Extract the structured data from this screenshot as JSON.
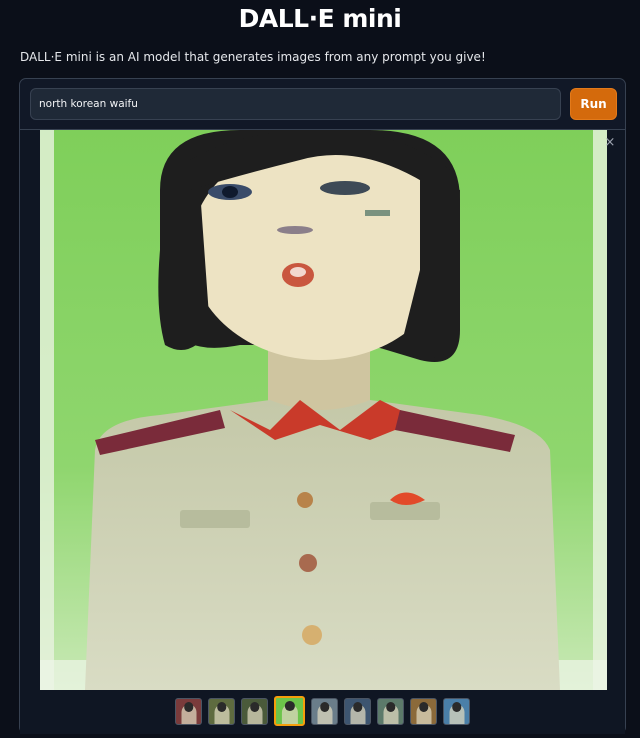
{
  "app": {
    "title": "DALL·E mini",
    "description": "DALL·E mini is an AI model that generates images from any prompt you give!"
  },
  "prompt": {
    "value": "north korean waifu"
  },
  "run_button": {
    "label": "Run"
  },
  "gallery": {
    "close_icon": "×",
    "selected_index": 3,
    "thumbnails": [
      {
        "bg": "#7a3b3b"
      },
      {
        "bg": "#5e6b3f"
      },
      {
        "bg": "#4a5a3a"
      },
      {
        "bg": "#6cc44a"
      },
      {
        "bg": "#6a7d8a"
      },
      {
        "bg": "#3d5570"
      },
      {
        "bg": "#5c7a6a"
      },
      {
        "bg": "#8b6a3a"
      },
      {
        "bg": "#4a7fa8"
      }
    ]
  }
}
